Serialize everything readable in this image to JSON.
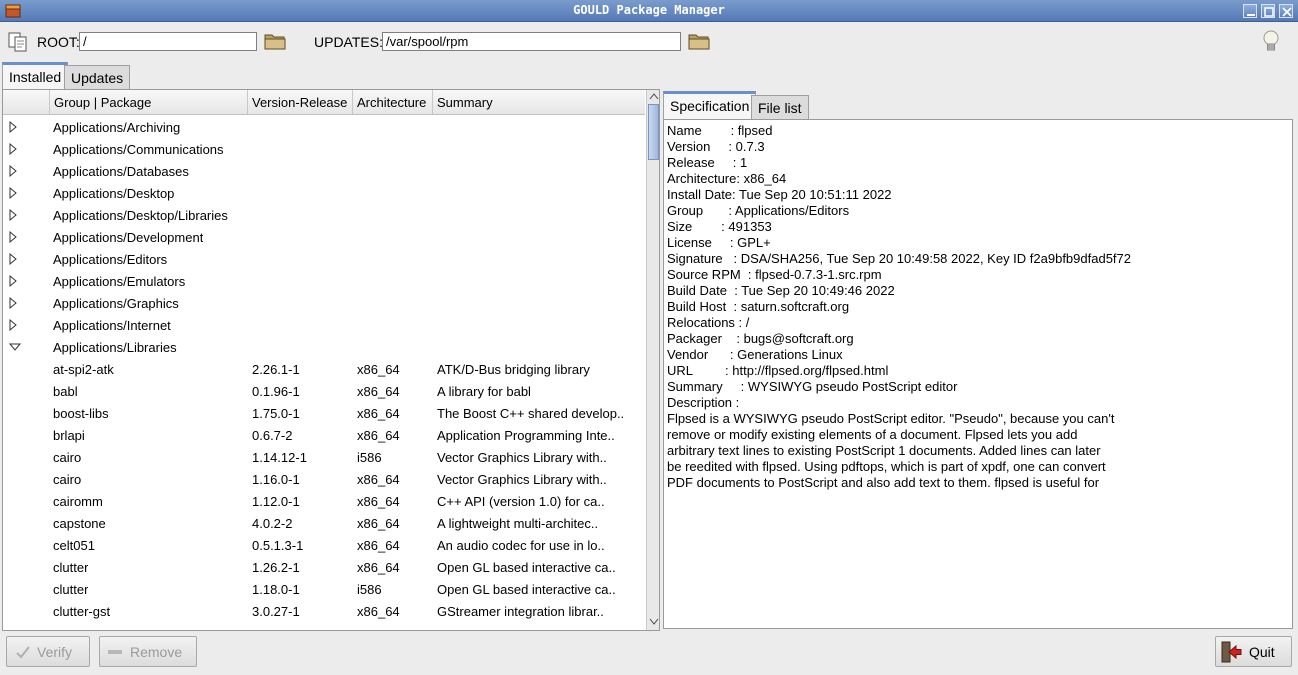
{
  "window": {
    "title": "GOULD Package Manager"
  },
  "toolbar": {
    "root_label": "ROOT:",
    "root_value": "/",
    "updates_label": "UPDATES:",
    "updates_value": "/var/spool/rpm"
  },
  "main_tabs": [
    {
      "label": "Installed",
      "active": true
    },
    {
      "label": "Updates",
      "active": false
    }
  ],
  "columns": [
    "Group | Package",
    "Version-Release",
    "Architecture",
    "Summary"
  ],
  "groups": [
    "Applications/Archiving",
    "Applications/Communications",
    "Applications/Databases",
    "Applications/Desktop",
    "Applications/Desktop/Libraries",
    "Applications/Development",
    "Applications/Editors",
    "Applications/Emulators",
    "Applications/Graphics",
    "Applications/Internet"
  ],
  "expanded_group": "Applications/Libraries",
  "packages": [
    {
      "name": "at-spi2-atk",
      "version": "2.26.1-1",
      "arch": "x86_64",
      "summary": "ATK/D-Bus bridging library"
    },
    {
      "name": "babl",
      "version": "0.1.96-1",
      "arch": "x86_64",
      "summary": "A library for babl"
    },
    {
      "name": "boost-libs",
      "version": "1.75.0-1",
      "arch": "x86_64",
      "summary": "The Boost C++ shared develop.."
    },
    {
      "name": "brlapi",
      "version": "0.6.7-2",
      "arch": "x86_64",
      "summary": "Application Programming Inte.."
    },
    {
      "name": "cairo",
      "version": "1.14.12-1",
      "arch": "i586",
      "summary": "Vector Graphics Library with.."
    },
    {
      "name": "cairo",
      "version": "1.16.0-1",
      "arch": "x86_64",
      "summary": "Vector Graphics Library with.."
    },
    {
      "name": "cairomm",
      "version": "1.12.0-1",
      "arch": "x86_64",
      "summary": "C++ API (version 1.0) for ca.."
    },
    {
      "name": "capstone",
      "version": "4.0.2-2",
      "arch": "x86_64",
      "summary": "A lightweight multi-architec.."
    },
    {
      "name": "celt051",
      "version": "0.5.1.3-1",
      "arch": "x86_64",
      "summary": "An audio codec for use in lo.."
    },
    {
      "name": "clutter",
      "version": "1.26.2-1",
      "arch": "x86_64",
      "summary": "Open GL based interactive ca.."
    },
    {
      "name": "clutter",
      "version": "1.18.0-1",
      "arch": "i586",
      "summary": "Open GL based interactive ca.."
    },
    {
      "name": "clutter-gst",
      "version": "3.0.27-1",
      "arch": "x86_64",
      "summary": "GStreamer integration librar.."
    }
  ],
  "detail_tabs": [
    {
      "label": "Specification",
      "active": true
    },
    {
      "label": "File list",
      "active": false
    }
  ],
  "spec_lines": [
    "Name        : flpsed",
    "Version     : 0.7.3",
    "Release     : 1",
    "Architecture: x86_64",
    "Install Date: Tue Sep 20 10:51:11 2022",
    "Group       : Applications/Editors",
    "Size        : 491353",
    "License     : GPL+",
    "Signature   : DSA/SHA256, Tue Sep 20 10:49:58 2022, Key ID f2a9bfb9dfad5f72",
    "Source RPM  : flpsed-0.7.3-1.src.rpm",
    "Build Date  : Tue Sep 20 10:49:46 2022",
    "Build Host  : saturn.softcraft.org",
    "Relocations : /",
    "Packager    : bugs@softcraft.org",
    "Vendor      : Generations Linux",
    "URL         : http://flpsed.org/flpsed.html",
    "Summary     : WYSIWYG pseudo PostScript editor",
    "Description :",
    "Flpsed is a WYSIWYG pseudo PostScript editor. \"Pseudo\", because you can't",
    "remove or modify existing elements of a document. Flpsed lets you add",
    "arbitrary text lines to existing PostScript 1 documents. Added lines can later",
    "be reedited with flpsed. Using pdftops, which is part of xpdf, one can convert",
    "PDF documents to PostScript and also add text to them. flpsed is useful for"
  ],
  "buttons": {
    "verify": "Verify",
    "remove": "Remove",
    "quit": "Quit"
  },
  "colors": {
    "titlebar": "#5f83bf",
    "tab_accent": "#6a8fc9",
    "quit_arrow": "#cc2222"
  },
  "icons": [
    "app-icon",
    "minimize-icon",
    "maximize-icon",
    "close-icon",
    "document-icon",
    "folder-icon",
    "lightbulb-icon",
    "expander-icon",
    "check-icon",
    "minus-icon",
    "exit-icon"
  ]
}
